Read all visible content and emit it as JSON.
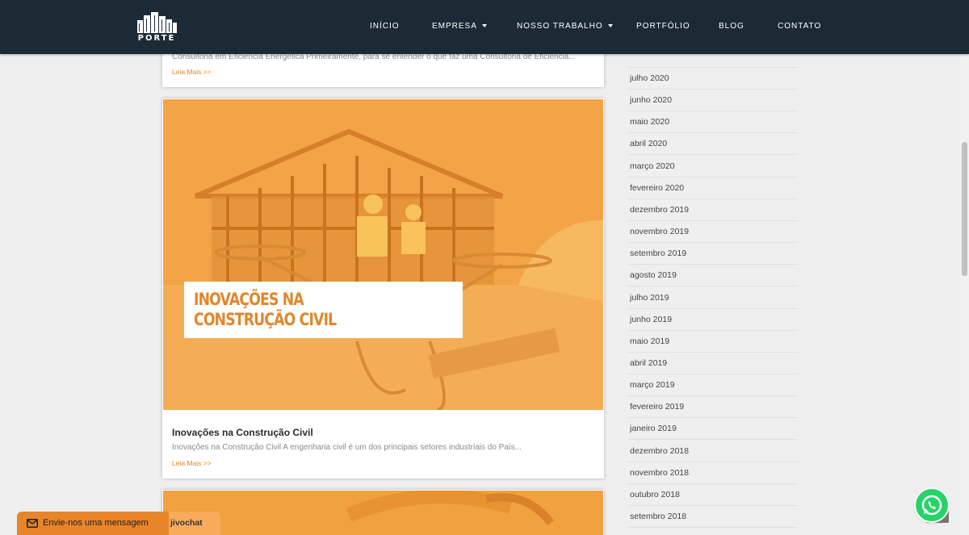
{
  "header": {
    "logo_text": "PORTE",
    "nav": [
      {
        "label": "INÍCIO",
        "dropdown": false
      },
      {
        "label": "EMPRESA",
        "dropdown": true
      },
      {
        "label": "NOSSO TRABALHO",
        "dropdown": true
      },
      {
        "label": "PORTFÓLIO",
        "dropdown": false
      },
      {
        "label": "BLOG",
        "dropdown": false
      },
      {
        "label": "CONTATO",
        "dropdown": false
      }
    ]
  },
  "posts": [
    {
      "excerpt": "Consultoria em Eficiência Energética Primeiramente, para se entender o que faz uma Consultoria de Eficiência...",
      "read_more": "Leia Mais >>"
    },
    {
      "image_banner_line1": "INOVAÇÕES NA",
      "image_banner_line2": "CONSTRUÇÃO CIVIL",
      "title": "Inovações na Construção Civil",
      "excerpt": "Inovações na Construção Civil A engenharia civil é um dos principais setores industriais do País...",
      "read_more": "Leia Mais >>"
    }
  ],
  "sidebar": {
    "archives": [
      "julho 2020",
      "junho 2020",
      "maio 2020",
      "abril 2020",
      "março 2020",
      "fevereiro 2020",
      "dezembro 2019",
      "novembro 2019",
      "setembro 2019",
      "agosto 2019",
      "julho 2019",
      "junho 2019",
      "maio 2019",
      "abril 2019",
      "março 2019",
      "fevereiro 2019",
      "janeiro 2019",
      "dezembro 2018",
      "novembro 2018",
      "outubro 2018",
      "setembro 2018"
    ]
  },
  "chat": {
    "label": "Envie-nos uma mensagem",
    "brand": "jivochat"
  },
  "colors": {
    "header_bg": "#1b2a35",
    "accent": "#e8842a",
    "whatsapp": "#25d366"
  }
}
